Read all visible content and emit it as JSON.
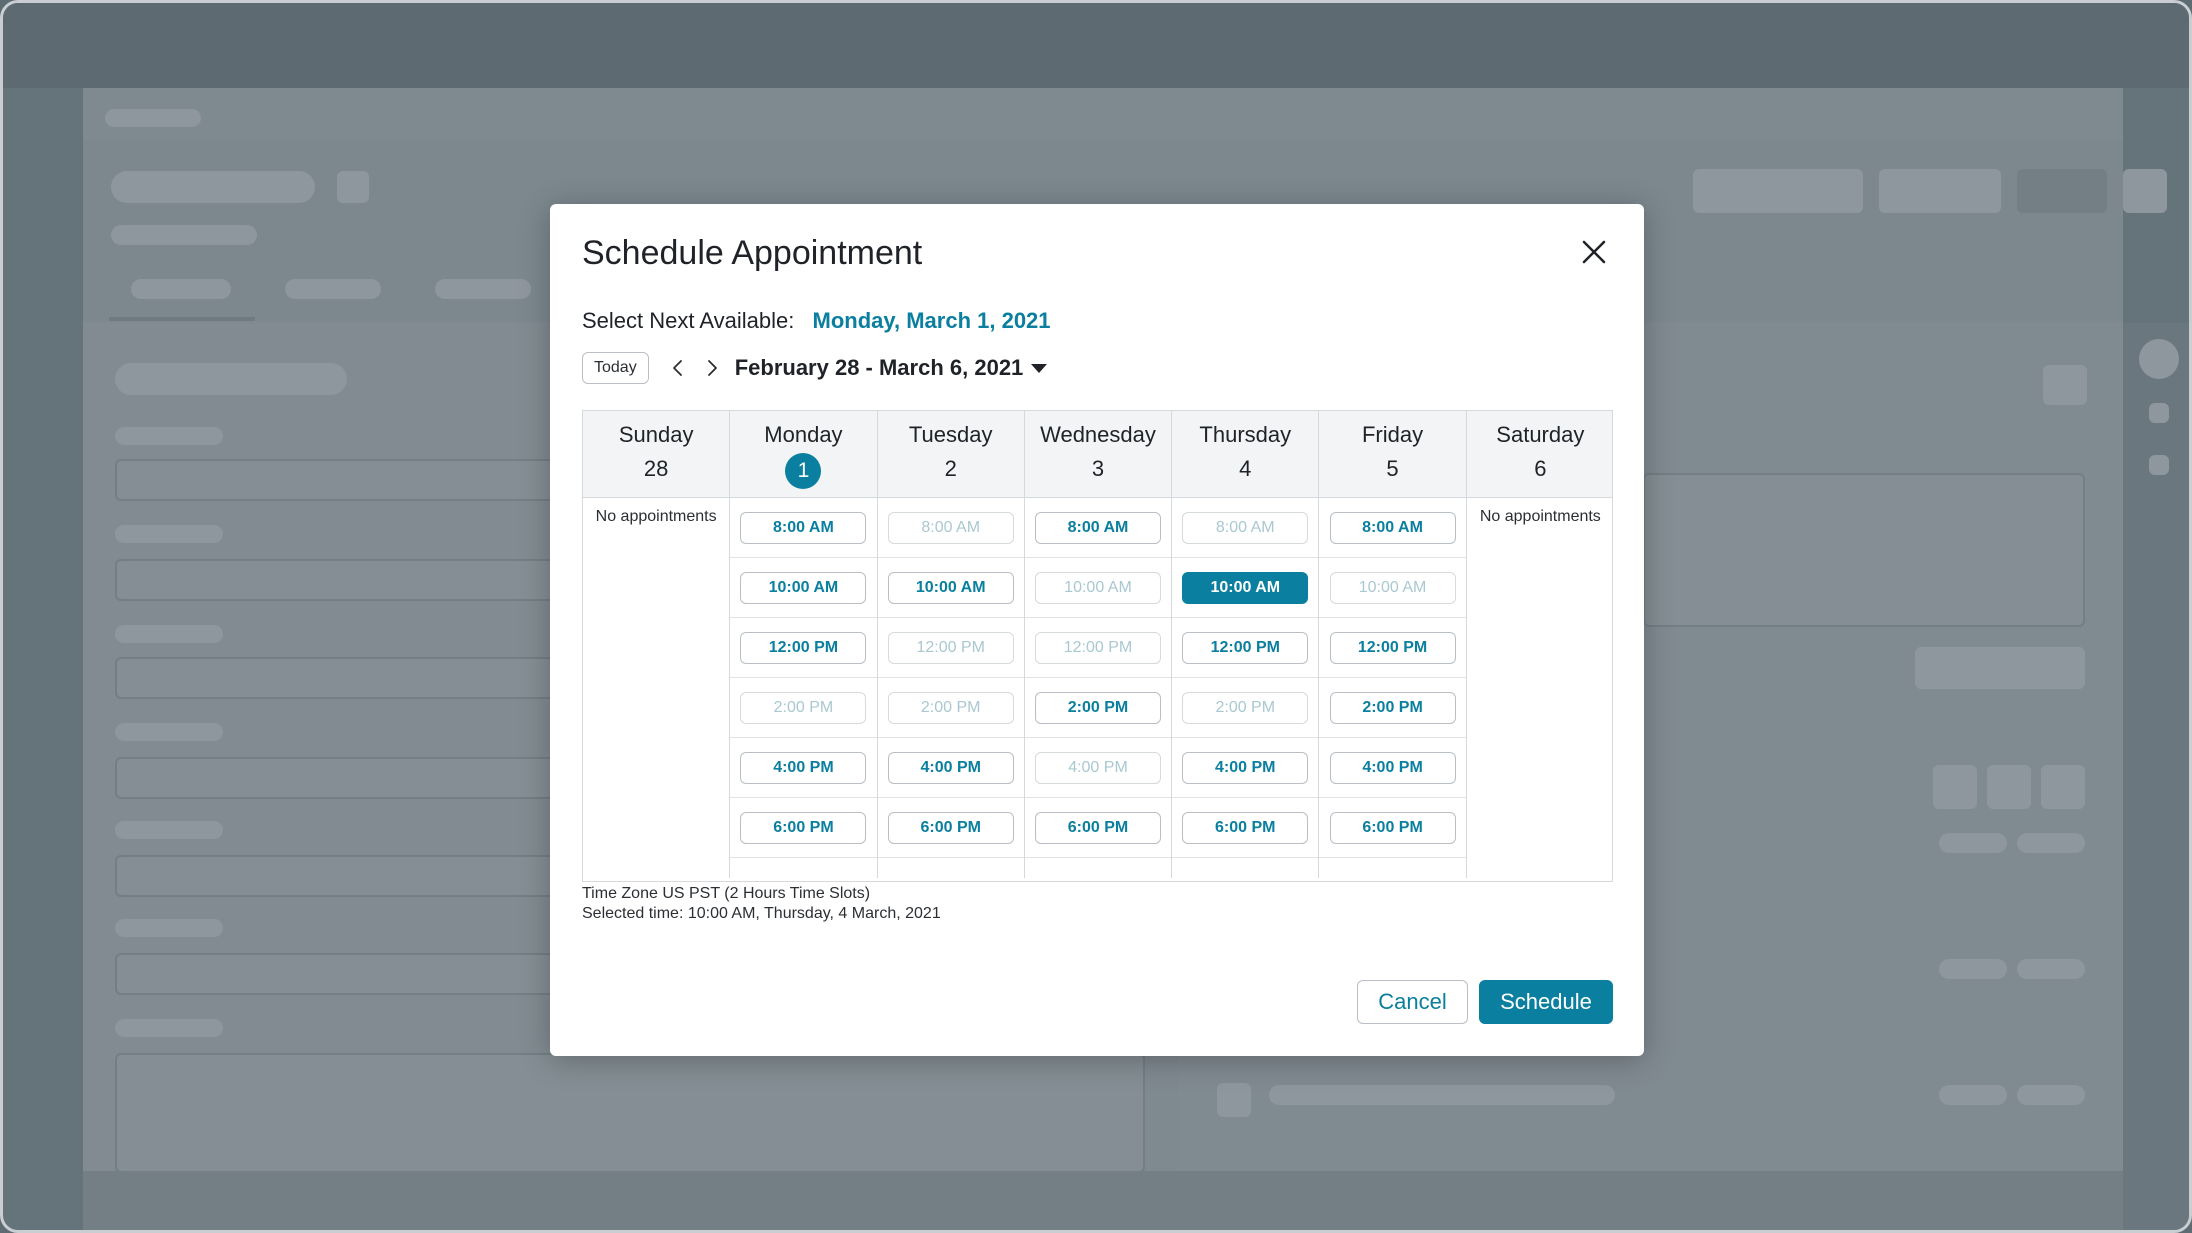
{
  "modal": {
    "title": "Schedule Appointment",
    "next_available_label": "Select Next Available:",
    "next_available_date": "Monday, March 1, 2021",
    "today_label": "Today",
    "range_label": "February 28 - March 6, 2021",
    "no_appointments": "No appointments",
    "days": [
      {
        "name": "Sunday",
        "num": "28"
      },
      {
        "name": "Monday",
        "num": "1"
      },
      {
        "name": "Tuesday",
        "num": "2"
      },
      {
        "name": "Wednesday",
        "num": "3"
      },
      {
        "name": "Thursday",
        "num": "4"
      },
      {
        "name": "Friday",
        "num": "5"
      },
      {
        "name": "Saturday",
        "num": "6"
      }
    ],
    "slots": {
      "monday": [
        "8:00 AM",
        "10:00 AM",
        "12:00 PM",
        "2:00 PM",
        "4:00 PM",
        "6:00 PM"
      ],
      "tuesday": [
        "8:00 AM",
        "10:00 AM",
        "12:00 PM",
        "2:00 PM",
        "4:00 PM",
        "6:00 PM"
      ],
      "wednesday": [
        "8:00 AM",
        "10:00 AM",
        "12:00 PM",
        "2:00 PM",
        "4:00 PM",
        "6:00 PM"
      ],
      "thursday": [
        "8:00 AM",
        "10:00 AM",
        "12:00 PM",
        "2:00 PM",
        "4:00 PM",
        "6:00 PM"
      ],
      "friday": [
        "8:00 AM",
        "10:00 AM",
        "12:00 PM",
        "2:00 PM",
        "4:00 PM",
        "6:00 PM"
      ]
    },
    "timezone_text": "Time Zone US PST (2 Hours Time Slots)",
    "selected_text": "Selected time: 10:00 AM, Thursday, 4 March, 2021",
    "cancel_label": "Cancel",
    "schedule_label": "Schedule"
  },
  "colors": {
    "accent": "#0a7f9f",
    "disabled_text": "#a9c8d1",
    "overlay": "#65737b"
  },
  "icons": {
    "close": "close-icon",
    "prev": "chevron-left-icon",
    "next": "chevron-right-icon",
    "dropdown": "caret-down-icon"
  }
}
